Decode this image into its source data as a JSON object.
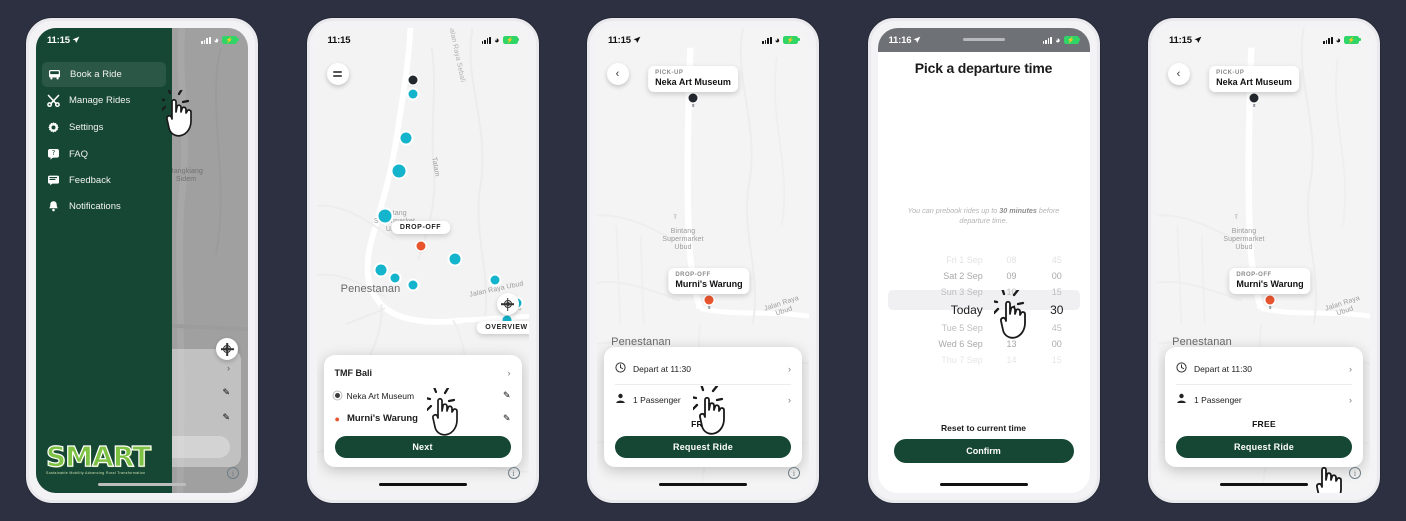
{
  "background_color": "#2c3040",
  "brand_color": "#154734",
  "accent_teal": "#14b4cd",
  "accent_red": "#e8542e",
  "phones": [
    {
      "id": "phone-drawer",
      "status": {
        "time": "11:15",
        "battery": "charging"
      },
      "drawer": {
        "items": [
          {
            "label": "Book a Ride",
            "icon": "bus-icon",
            "active": true
          },
          {
            "label": "Manage Rides",
            "icon": "tools-icon",
            "active": false
          },
          {
            "label": "Settings",
            "icon": "gear-icon",
            "active": false
          },
          {
            "label": "FAQ",
            "icon": "chat-question-icon",
            "active": false
          },
          {
            "label": "Feedback",
            "icon": "feedback-icon",
            "active": false
          },
          {
            "label": "Notifications",
            "icon": "bell-icon",
            "active": false
          }
        ],
        "logo": {
          "word": "SMART",
          "tagline": "Sustainable Mobility Advancing Rural Transformation"
        }
      },
      "map_labels": [
        {
          "text": "Bangkiang\nSidem"
        }
      ],
      "cursor": {
        "target": "Book a Ride"
      }
    },
    {
      "id": "phone-route",
      "status": {
        "time": "11:15"
      },
      "map_labels": [
        {
          "text": "Bintang\nSupermarket\nUbud"
        },
        {
          "text": "Penestanan"
        },
        {
          "text": "Ubud"
        },
        {
          "text": "Jalan Raya Ubud"
        },
        {
          "text": "Jalan Raya Sebali"
        },
        {
          "text": "Tatam"
        }
      ],
      "chips": [
        {
          "text": "DROP-OFF"
        },
        {
          "text": "OVERVIEW"
        }
      ],
      "buttons": {
        "menu": "hamburger-icon",
        "recenter": "crosshair-icon"
      },
      "sheet": {
        "title": "TMF Bali",
        "pickup": "Neka Art Museum",
        "dropoff": "Murni's Warung",
        "cta": "Next"
      },
      "cursor": {
        "target": "Neka Art Museum row"
      }
    },
    {
      "id": "phone-confirm",
      "status": {
        "time": "11:15"
      },
      "back_button": "chevron-left-icon",
      "callouts": [
        {
          "kicker": "PICK-UP",
          "value": "Neka Art Museum"
        },
        {
          "kicker": "DROP-OFF",
          "value": "Murni's Warung"
        }
      ],
      "map_labels": [
        {
          "text": "Bintang\nSupermarket\nUbud"
        },
        {
          "text": "Penestanan"
        },
        {
          "text": "Jalan Raya Ubud"
        }
      ],
      "sheet": {
        "depart": "Depart at 11:30",
        "passengers": "1 Passenger",
        "price": "FREE",
        "cta": "Request Ride"
      },
      "cursor": {
        "target": "Depart at 11:30 row"
      }
    },
    {
      "id": "phone-timepicker",
      "status": {
        "time": "11:16"
      },
      "title": "Pick a departure time",
      "note_prefix": "You can prebook rides up to ",
      "note_bold": "30 minutes",
      "note_suffix": " before departure time.",
      "picker": {
        "days": [
          "Fri 1 Sep",
          "Sat 2 Sep",
          "Sun 3 Sep",
          "Today",
          "Tue 5 Sep",
          "Wed 6 Sep",
          "Thu 7 Sep"
        ],
        "hours": [
          "08",
          "09",
          "10",
          "11",
          "12",
          "13",
          "14"
        ],
        "minutes": [
          "45",
          "00",
          "15",
          "30",
          "45",
          "00",
          "15"
        ],
        "selected_day": "Today",
        "selected_hour": "11",
        "selected_minute": "30",
        "selected_index": 3
      },
      "reset_label": "Reset to current time",
      "confirm_label": "Confirm",
      "cursor": {
        "target": "selected time row"
      }
    },
    {
      "id": "phone-request",
      "status": {
        "time": "11:15"
      },
      "back_button": "chevron-left-icon",
      "callouts": [
        {
          "kicker": "PICK-UP",
          "value": "Neka Art Museum"
        },
        {
          "kicker": "DROP-OFF",
          "value": "Murni's Warung"
        }
      ],
      "map_labels": [
        {
          "text": "Bintang\nSupermarket\nUbud"
        },
        {
          "text": "Penestanan"
        },
        {
          "text": "Jalan Raya Ubud"
        }
      ],
      "sheet": {
        "depart": "Depart at 11:30",
        "passengers": "1 Passenger",
        "price": "FREE",
        "cta": "Request Ride"
      },
      "cursor": {
        "target": "Request Ride button"
      }
    }
  ]
}
